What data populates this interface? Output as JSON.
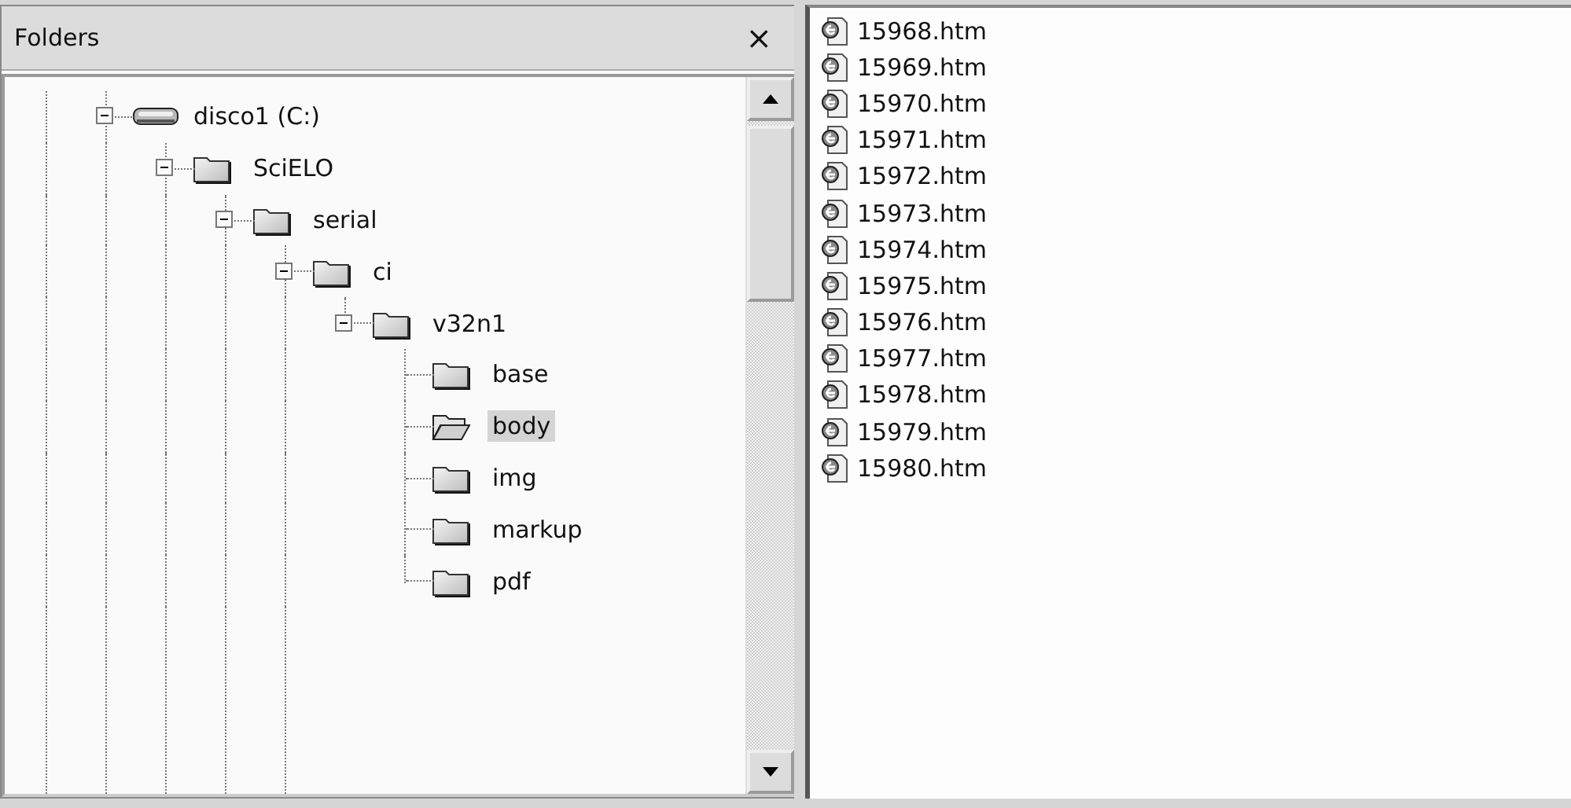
{
  "folders_pane": {
    "title": "Folders",
    "close": "×",
    "tree": [
      {
        "label": "disco1 (C:)",
        "kind": "drive",
        "expanded": true,
        "selected": false,
        "has_next_sibling": true,
        "children": [
          {
            "label": "SciELO",
            "kind": "folder",
            "expanded": true,
            "selected": false,
            "has_next_sibling": true,
            "children": [
              {
                "label": "serial",
                "kind": "folder",
                "expanded": true,
                "selected": false,
                "has_next_sibling": true,
                "children": [
                  {
                    "label": "ci",
                    "kind": "folder",
                    "expanded": true,
                    "selected": false,
                    "has_next_sibling": true,
                    "children": [
                      {
                        "label": "v32n1",
                        "kind": "folder",
                        "expanded": true,
                        "selected": false,
                        "has_next_sibling": false,
                        "children": [
                          {
                            "label": "base",
                            "kind": "folder",
                            "selected": false,
                            "has_next_sibling": true
                          },
                          {
                            "label": "body",
                            "kind": "folder",
                            "selected": true,
                            "has_next_sibling": true
                          },
                          {
                            "label": "img",
                            "kind": "folder",
                            "selected": false,
                            "has_next_sibling": true
                          },
                          {
                            "label": "markup",
                            "kind": "folder",
                            "selected": false,
                            "has_next_sibling": true
                          },
                          {
                            "label": "pdf",
                            "kind": "folder",
                            "selected": false,
                            "has_next_sibling": false
                          }
                        ]
                      }
                    ]
                  }
                ]
              }
            ]
          }
        ]
      }
    ]
  },
  "file_list": {
    "files": [
      "15968.htm",
      "15969.htm",
      "15970.htm",
      "15971.htm",
      "15972.htm",
      "15973.htm",
      "15974.htm",
      "15975.htm",
      "15976.htm",
      "15977.htm",
      "15978.htm",
      "15979.htm",
      "15980.htm"
    ]
  }
}
